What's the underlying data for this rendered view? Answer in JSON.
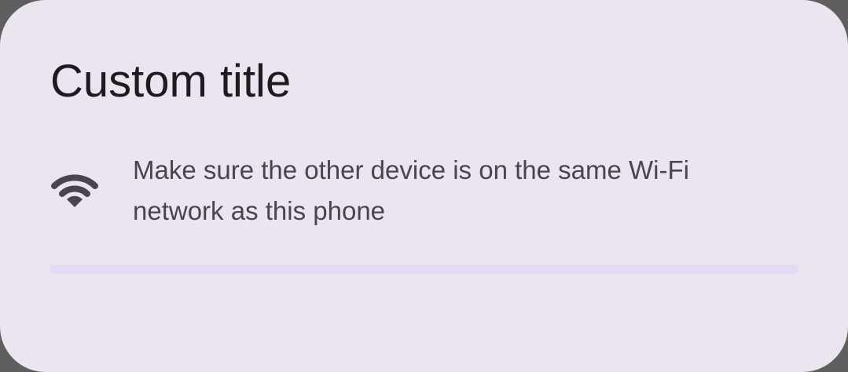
{
  "dialog": {
    "title": "Custom title",
    "message": "Make sure the other device is on the same Wi-Fi network as this phone",
    "icon": "wifi-icon",
    "progress": 0,
    "colors": {
      "surface": "#ebe5ef",
      "title_text": "#1d1b20",
      "body_text": "#49454f",
      "icon": "#49454f",
      "progress_track": "#e3dbf3",
      "progress_indicator": "#6750a4"
    }
  }
}
